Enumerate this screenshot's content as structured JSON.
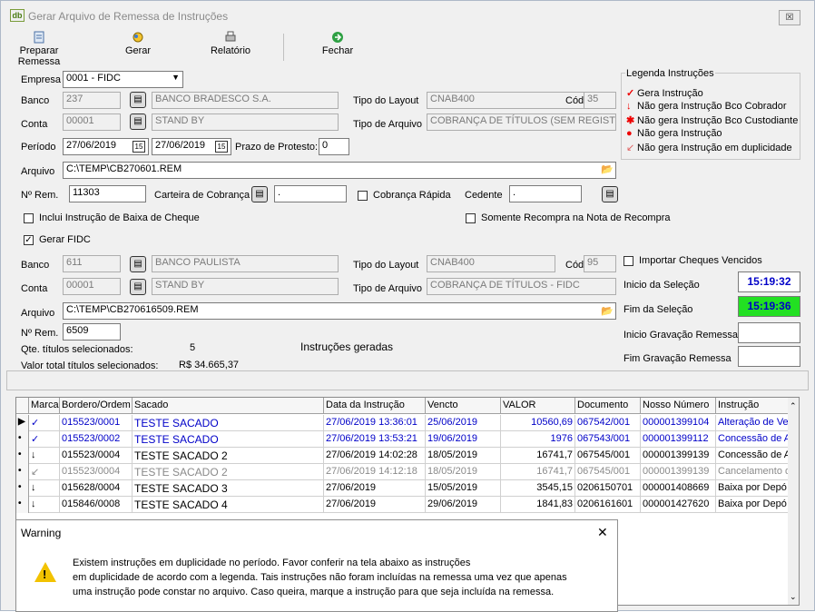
{
  "window": {
    "title": "Gerar Arquivo de Remessa de Instruções",
    "close": "☒",
    "logo": "db"
  },
  "toolbar": {
    "preparar": "Preparar Remessa",
    "gerar": "Gerar",
    "relatorio": "Relatório",
    "fechar": "Fechar"
  },
  "form": {
    "empresa_label": "Empresa",
    "empresa_value": "0001 - FIDC",
    "banco_label": "Banco",
    "banco_code": "237",
    "banco_name": "BANCO BRADESCO S.A.",
    "tipo_layout_label": "Tipo do Layout",
    "tipo_layout_value": "CNAB400",
    "cod_label": "Cód",
    "cod_value": "35",
    "conta_label": "Conta",
    "conta_code": "00001",
    "conta_name": "STAND BY",
    "tipo_arquivo_label": "Tipo de Arquivo",
    "tipo_arquivo_value": "COBRANÇA DE TÍTULOS (SEM REGISTF",
    "periodo_label": "Período",
    "periodo_inicio": "27/06/2019",
    "periodo_fim": "27/06/2019",
    "prazo_label": "Prazo de Protesto:",
    "prazo_value": "0",
    "arquivo_label": "Arquivo",
    "arquivo_value": "C:\\TEMP\\CB270601.REM",
    "nrem_label": "Nº Rem.",
    "nrem_value": "11303",
    "carteira_label": "Carteira de Cobrança",
    "carteira_value": " .",
    "cobranca_rapida_label": "Cobrança Rápida",
    "cedente_label": "Cedente",
    "cedente_value": " .",
    "inclui_label": "Inclui Instrução de Baixa de Cheque",
    "somente_label": "Somente Recompra na Nota de Recompra",
    "gerar_fidc_label": "Gerar FIDC",
    "banco2_code": "611",
    "banco2_name": "BANCO PAULISTA",
    "tipo_layout2_value": "CNAB400",
    "cod2_value": "95",
    "importar_label": "Importar Cheques Vencidos",
    "conta2_code": "00001",
    "conta2_name": "STAND BY",
    "tipo_arquivo2_value": "COBRANÇA DE TÍTULOS - FIDC",
    "arquivo2_value": "C:\\TEMP\\CB270616509.REM",
    "nrem2_value": "6509",
    "qte_label": "Qte. títulos selecionados:",
    "qte_value": "5",
    "valor_label": "Valor total títulos selecionados:",
    "valor_value": "R$ 34.665,37",
    "instrucoes_geradas": "Instruções geradas",
    "inicio_selecao_label": "Inicio da Seleção",
    "inicio_selecao_value": "15:19:32",
    "fim_selecao_label": "Fim da Seleção",
    "fim_selecao_value": "15:19:36",
    "inicio_grav_label": "Inicio Gravação Remessa",
    "fim_grav_label": "Fim Gravação Remessa"
  },
  "legend": {
    "title": "Legenda Instruções",
    "items": [
      "Gera Instrução",
      "Não gera Instrução Bco Cobrador",
      "Não gera Instrução Bco Custodiante",
      "Não gera Instrução",
      "Não gera Instrução em duplicidade"
    ]
  },
  "grid": {
    "columns": [
      "Marca",
      "Bordero/Ordem",
      "Sacado",
      "Data da Instrução",
      "Vencto",
      "VALOR",
      "Documento",
      "Nosso Número",
      "Instrução"
    ],
    "rows": [
      {
        "marca": "✓",
        "bordero": "015523/0001",
        "sacado": "TESTE SACADO",
        "data": "27/06/2019 13:36:01",
        "vencto": "25/06/2019",
        "valor": "10560,69",
        "doc": "067542/001",
        "nosso": "000001399104",
        "instrucao": "Alteração de Ve"
      },
      {
        "marca": "✓",
        "bordero": "015523/0002",
        "sacado": "TESTE SACADO",
        "data": "27/06/2019 13:53:21",
        "vencto": "19/06/2019",
        "valor": "1976",
        "doc": "067543/001",
        "nosso": "000001399112",
        "instrucao": "Concessão de A"
      },
      {
        "marca": "↓",
        "bordero": "015523/0004",
        "sacado": "TESTE SACADO 2",
        "data": "27/06/2019 14:02:28",
        "vencto": "18/05/2019",
        "valor": "16741,7",
        "doc": "067545/001",
        "nosso": "000001399139",
        "instrucao": "Concessão de A"
      },
      {
        "marca": "↙",
        "bordero": "015523/0004",
        "sacado": "TESTE SACADO 2",
        "data": "27/06/2019 14:12:18",
        "vencto": "18/05/2019",
        "valor": "16741,7",
        "doc": "067545/001",
        "nosso": "000001399139",
        "instrucao": "Cancelamento d"
      },
      {
        "marca": "↓",
        "bordero": "015628/0004",
        "sacado": "TESTE SACADO 3",
        "data": "27/06/2019",
        "vencto": "15/05/2019",
        "valor": "3545,15",
        "doc": "0206150701",
        "nosso": "000001408669",
        "instrucao": "Baixa por Depó"
      },
      {
        "marca": "↓",
        "bordero": "015846/0008",
        "sacado": "TESTE SACADO 4",
        "data": "27/06/2019",
        "vencto": "29/06/2019",
        "valor": "1841,83",
        "doc": "0206161601",
        "nosso": "000001427620",
        "instrucao": "Baixa por Depó"
      }
    ]
  },
  "dialog": {
    "title": "Warning",
    "line1": "Existem instruções em duplicidade no período. Favor conferir na tela abaixo as instruções",
    "line2": "em duplicidade de acordo com a legenda. Tais instruções não foram incluídas na remessa uma vez que apenas",
    "line3": "uma instrução pode constar no arquivo. Caso queira, marque a instrução para que seja incluída na remessa."
  }
}
